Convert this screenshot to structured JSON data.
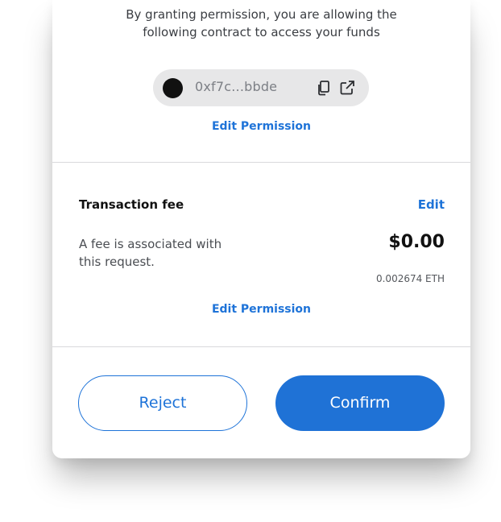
{
  "intro": {
    "line1": "By granting permission, you are allowing the",
    "line2": "following contract to access your funds"
  },
  "contract": {
    "address": "0xf7c...bbde",
    "copy_icon": "copy-icon",
    "open_icon": "external-link-icon"
  },
  "permission_link_top": "Edit Permission",
  "fee": {
    "title": "Transaction fee",
    "edit_label": "Edit",
    "description_line1": "A fee is associated with",
    "description_line2": "this request.",
    "amount_usd": "$0.00",
    "amount_eth": "0.002674 ETH"
  },
  "permission_link_bottom": "Edit Permission",
  "actions": {
    "reject_label": "Reject",
    "confirm_label": "Confirm"
  },
  "colors": {
    "accent": "#1e73d8",
    "pill_background": "#e7e7e8",
    "divider": "#d9d9dc"
  }
}
